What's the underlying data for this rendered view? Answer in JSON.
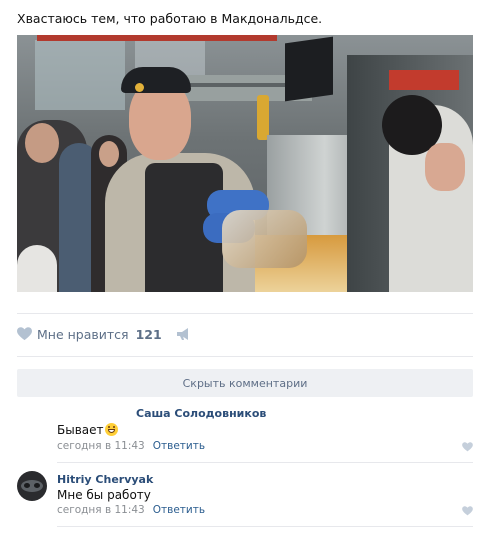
{
  "post": {
    "text": "Хвастаюсь тем, что работаю в Макдональдсе.",
    "image_subject": "photo"
  },
  "actions": {
    "like_label": "Мне нравится",
    "like_count": "121",
    "heart_icon": "heart-icon",
    "share_icon": "megaphone-icon"
  },
  "comments_toggle": {
    "label": "Скрыть комментарии"
  },
  "comments": [
    {
      "author": "Саша Солодовников",
      "text": "Бывает",
      "emoji": "grinning-face",
      "time": "сегодня в 11:43",
      "reply_label": "Ответить"
    },
    {
      "author": "Hitriy Chervyak",
      "text": "Мне бы работу",
      "time": "сегодня в 11:43",
      "reply_label": "Ответить"
    }
  ],
  "colors": {
    "link": "#2b4d78",
    "meta": "#8a8e93",
    "action": "#5d6f87",
    "button_bg": "#eef0f3"
  }
}
